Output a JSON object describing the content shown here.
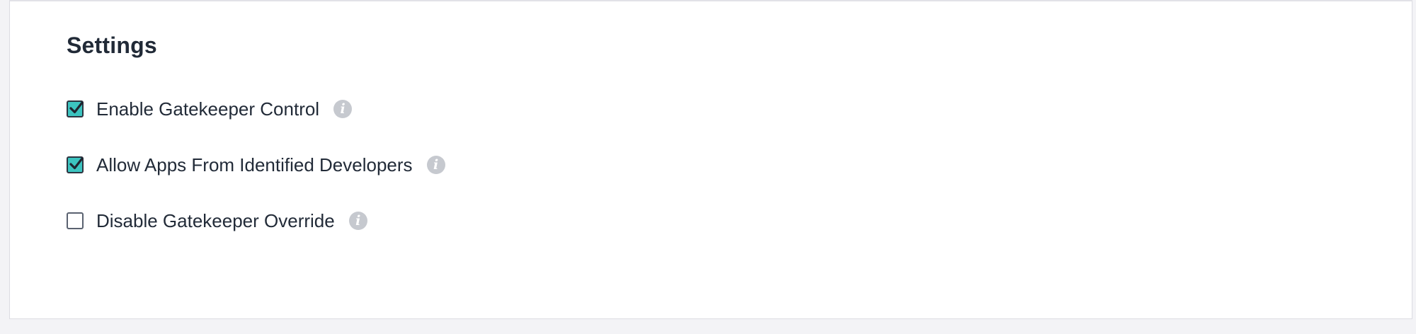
{
  "settings": {
    "title": "Settings",
    "options": [
      {
        "label": "Enable Gatekeeper Control",
        "checked": true,
        "info_icon": "info-icon",
        "info_glyph": "i"
      },
      {
        "label": "Allow Apps From Identified Developers",
        "checked": true,
        "info_icon": "info-icon",
        "info_glyph": "i"
      },
      {
        "label": "Disable Gatekeeper Override",
        "checked": false,
        "info_icon": "info-icon",
        "info_glyph": "i"
      }
    ]
  },
  "colors": {
    "checkbox_checked_fill": "#3cc4c0",
    "text": "#212a37",
    "info_icon": "#c6c9cf"
  }
}
